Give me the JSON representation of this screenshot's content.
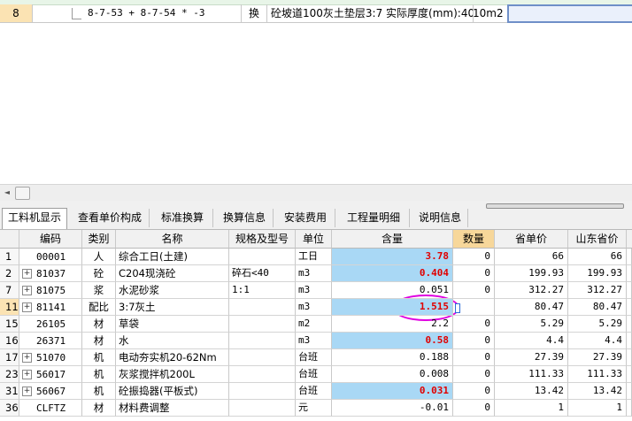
{
  "top_row": {
    "num": "8",
    "code": "8-7-53 + 8-7-54 * -3",
    "type": "换",
    "name": "砼坡道100灰土垫层3:7  实际厚度(mm):40",
    "unit": "10m2"
  },
  "tabs": [
    "工料机显示",
    "查看单价构成",
    "标准换算",
    "换算信息",
    "安装费用",
    "工程量明细",
    "说明信息"
  ],
  "columns": [
    "编码",
    "类别",
    "名称",
    "规格及型号",
    "单位",
    "含量",
    "数量",
    "省单价",
    "山东省价"
  ],
  "rows": [
    {
      "num": "1",
      "expand": "",
      "code": "00001",
      "cat": "人",
      "name": "综合工日(土建)",
      "spec": "",
      "unit": "工日",
      "qty": "3.78",
      "count": "0",
      "price": "66",
      "sd": "66",
      "hl": true,
      "red": true
    },
    {
      "num": "2",
      "expand": "+",
      "code": "81037",
      "cat": "砼",
      "name": "C204现浇砼",
      "spec": "碎石<40",
      "unit": "m3",
      "qty": "0.404",
      "count": "0",
      "price": "199.93",
      "sd": "199.93",
      "hl": true,
      "red": true
    },
    {
      "num": "7",
      "expand": "+",
      "code": "81075",
      "cat": "浆",
      "name": "水泥砂浆",
      "spec": "1:1",
      "unit": "m3",
      "qty": "0.051",
      "count": "0",
      "price": "312.27",
      "sd": "312.27",
      "hl": false,
      "red": false
    },
    {
      "num": "11",
      "expand": "+",
      "code": "81141",
      "cat": "配比",
      "name": "3:7灰土",
      "spec": "",
      "unit": "m3",
      "qty": "1.515",
      "count": "",
      "price": "80.47",
      "sd": "80.47",
      "hl": true,
      "red": true
    },
    {
      "num": "15",
      "expand": "",
      "code": "26105",
      "cat": "材",
      "name": "草袋",
      "spec": "",
      "unit": "m2",
      "qty": "2.2",
      "count": "0",
      "price": "5.29",
      "sd": "5.29",
      "hl": false,
      "red": false
    },
    {
      "num": "16",
      "expand": "",
      "code": "26371",
      "cat": "材",
      "name": "水",
      "spec": "",
      "unit": "m3",
      "qty": "0.58",
      "count": "0",
      "price": "4.4",
      "sd": "4.4",
      "hl": true,
      "red": true
    },
    {
      "num": "17",
      "expand": "+",
      "code": "51070",
      "cat": "机",
      "name": "电动夯实机20-62Nm",
      "spec": "",
      "unit": "台班",
      "qty": "0.188",
      "count": "0",
      "price": "27.39",
      "sd": "27.39",
      "hl": false,
      "red": false
    },
    {
      "num": "23",
      "expand": "+",
      "code": "56017",
      "cat": "机",
      "name": "灰浆搅拌机200L",
      "spec": "",
      "unit": "台班",
      "qty": "0.008",
      "count": "0",
      "price": "111.33",
      "sd": "111.33",
      "hl": false,
      "red": false
    },
    {
      "num": "31",
      "expand": "+",
      "code": "56067",
      "cat": "机",
      "name": "砼振捣器(平板式)",
      "spec": "",
      "unit": "台班",
      "qty": "0.031",
      "count": "0",
      "price": "13.42",
      "sd": "13.42",
      "hl": true,
      "red": true
    },
    {
      "num": "36",
      "expand": "",
      "code": "CLFTZ",
      "cat": "材",
      "name": "材料费调整",
      "spec": "",
      "unit": "元",
      "qty": "-0.01",
      "count": "0",
      "price": "1",
      "sd": "1",
      "hl": false,
      "red": false
    }
  ]
}
